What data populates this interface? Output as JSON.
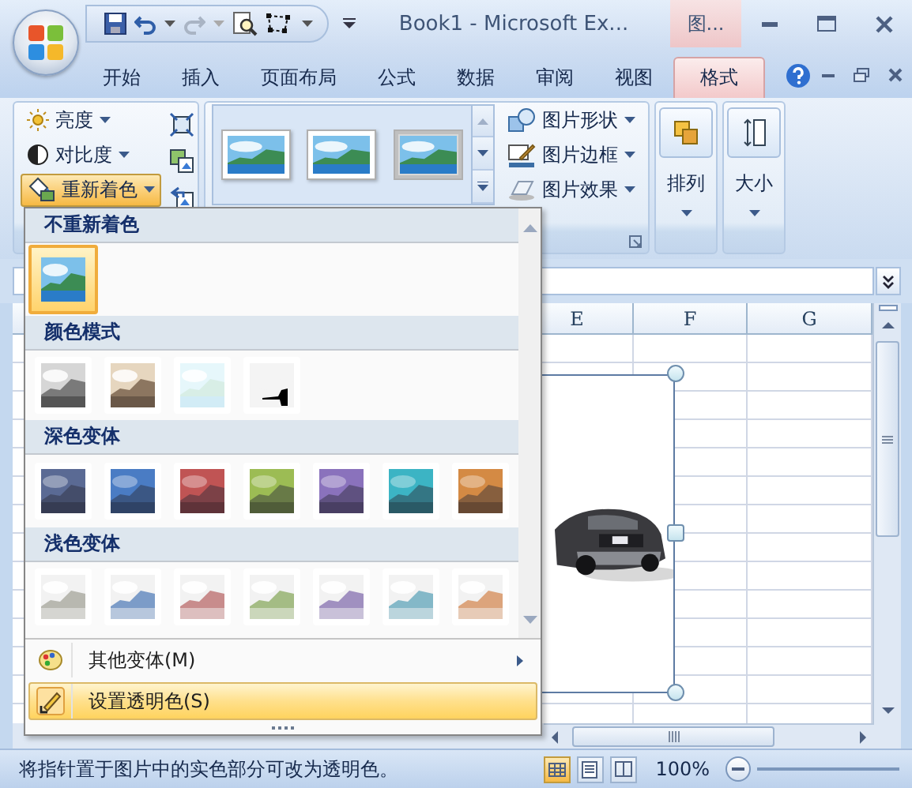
{
  "window": {
    "title": "Book1 - Microsoft Ex...",
    "context_tab": "图..."
  },
  "tabs": [
    {
      "label": "开始",
      "selected": false
    },
    {
      "label": "插入",
      "selected": false
    },
    {
      "label": "页面布局",
      "selected": false
    },
    {
      "label": "公式",
      "selected": false
    },
    {
      "label": "数据",
      "selected": false
    },
    {
      "label": "审阅",
      "selected": false
    },
    {
      "label": "视图",
      "selected": false
    },
    {
      "label": "格式",
      "selected": true
    }
  ],
  "ribbon": {
    "adjust": [
      {
        "kind": "brightness",
        "label": "亮度",
        "active": false
      },
      {
        "kind": "contrast",
        "label": "对比度",
        "active": false
      },
      {
        "kind": "recolor",
        "label": "重新着色",
        "active": true
      }
    ],
    "style_thumbnails": [
      {
        "kind": "simple-frame"
      },
      {
        "kind": "simple-frame"
      },
      {
        "kind": "shadow-frame"
      }
    ],
    "picture_tools": [
      {
        "kind": "shape",
        "label": "图片形状"
      },
      {
        "kind": "border",
        "label": "图片边框"
      },
      {
        "kind": "effects",
        "label": "图片效果"
      }
    ],
    "arrange": {
      "label": "排列"
    },
    "size": {
      "label": "大小"
    }
  },
  "columns": [
    "E",
    "F",
    "G"
  ],
  "recolor_menu": {
    "sections": [
      {
        "title": "不重新着色",
        "swatches": [
          {
            "kind": "original",
            "selected": true
          }
        ]
      },
      {
        "title": "颜色模式",
        "swatches": [
          {
            "kind": "grayscale",
            "selected": false
          },
          {
            "kind": "sepia",
            "selected": false
          },
          {
            "kind": "washout",
            "selected": false
          },
          {
            "kind": "black-white",
            "selected": false
          }
        ]
      },
      {
        "title": "深色变体",
        "swatches": [
          {
            "kind": "dark",
            "color": "#5a6a94",
            "selected": false
          },
          {
            "kind": "dark",
            "color": "#4a7cc4",
            "selected": false
          },
          {
            "kind": "dark",
            "color": "#c05454",
            "selected": false
          },
          {
            "kind": "dark",
            "color": "#9cbc54",
            "selected": false
          },
          {
            "kind": "dark",
            "color": "#8a72bc",
            "selected": false
          },
          {
            "kind": "dark",
            "color": "#3cb4c4",
            "selected": false
          },
          {
            "kind": "dark",
            "color": "#d48a44",
            "selected": false
          }
        ]
      },
      {
        "title": "浅色变体",
        "swatches": [
          {
            "kind": "light",
            "color": "#b8b8b0",
            "selected": false
          },
          {
            "kind": "light",
            "color": "#7c9cc8",
            "selected": false
          },
          {
            "kind": "light",
            "color": "#c88c8c",
            "selected": false
          },
          {
            "kind": "light",
            "color": "#a4bc84",
            "selected": false
          },
          {
            "kind": "light",
            "color": "#a090c0",
            "selected": false
          },
          {
            "kind": "light",
            "color": "#84b8c8",
            "selected": false
          },
          {
            "kind": "light",
            "color": "#dca47c",
            "selected": false
          }
        ]
      }
    ],
    "items": [
      {
        "kind": "palette",
        "label": "其他变体(M)",
        "has_submenu": true,
        "highlighted": false
      },
      {
        "kind": "pencil",
        "label": "设置透明色(S)",
        "has_submenu": false,
        "highlighted": true
      }
    ]
  },
  "status_bar": {
    "message": "将指针置于图片中的实色部分可改为透明色。",
    "zoom": "100%"
  }
}
